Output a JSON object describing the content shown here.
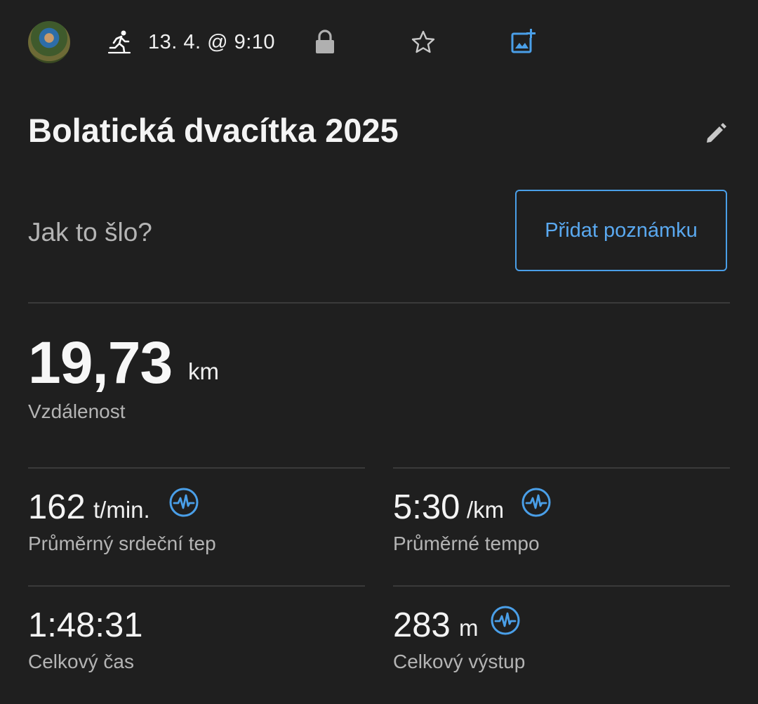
{
  "header": {
    "activity_icon": "running-icon",
    "date": "13. 4. @ 9:10",
    "privacy_icon": "lock-icon",
    "favorite_icon": "star-icon",
    "add_photo_icon": "add-photo-icon"
  },
  "activity": {
    "title": "Bolatická dvacítka 2025",
    "edit_icon": "pencil-icon",
    "prompt": "Jak to šlo?",
    "add_note_label": "Přidat poznámku"
  },
  "distance": {
    "value": "19,73",
    "unit": "km",
    "label": "Vzdálenost"
  },
  "stats": [
    {
      "value": "162",
      "unit": "t/min.",
      "label": "Průměrný srdeční tep",
      "icon": "heart-rate-pulse-icon"
    },
    {
      "value": "5:30",
      "unit": "/km",
      "label": "Průměrné tempo",
      "icon": "heart-rate-pulse-icon"
    },
    {
      "value": "1:48:31",
      "unit": "",
      "label": "Celkový čas"
    },
    {
      "value": "283",
      "unit": "m",
      "label": "Celkový výstup",
      "icon": "heart-rate-pulse-icon"
    }
  ],
  "colors": {
    "background": "#1f1f1f",
    "accent": "#4a9fe8",
    "text": "#f2f2f2",
    "muted": "#b4b4b4",
    "divider": "#3a3a3a"
  }
}
